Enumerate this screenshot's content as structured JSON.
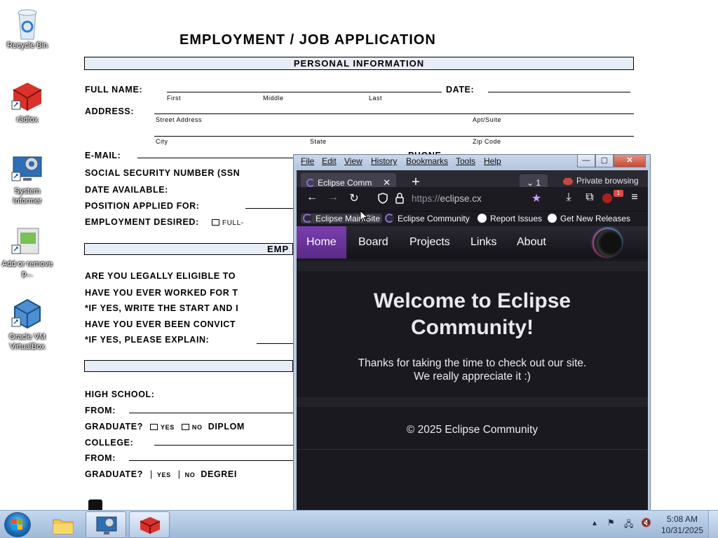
{
  "desktop": {
    "icons": [
      {
        "label": "Recycle Bin",
        "icon": "recycle-bin-icon"
      },
      {
        "label": "r3dfox",
        "icon": "r3dfox-icon"
      },
      {
        "label": "System Informer",
        "icon": "system-informer-icon"
      },
      {
        "label": "Add or remove p...",
        "icon": "add-remove-programs-icon"
      },
      {
        "label": "Oracle VM VirtualBox",
        "icon": "virtualbox-icon"
      }
    ]
  },
  "form": {
    "title": "EMPLOYMENT / JOB APPLICATION",
    "band_personal": "PERSONAL INFORMATION",
    "band_employment_partial": "EMP",
    "full_name_label": "FULL NAME:",
    "first": "First",
    "middle": "Middle",
    "last": "Last",
    "date_label": "DATE:",
    "address_label": "ADDRESS:",
    "street": "Street Address",
    "apt": "Apt/Suite",
    "city": "City",
    "state": "State",
    "zip": "Zip Code",
    "email_label": "E-MAIL:",
    "phone_label": "PHONE",
    "ssn_label": "SOCIAL SECURITY NUMBER (SSN",
    "date_available_label": "DATE AVAILABLE:",
    "position_label": "POSITION APPLIED FOR:",
    "employment_desired_label": "EMPLOYMENT DESIRED:",
    "full_time_partial": "FULL-",
    "eligible_partial": "ARE YOU LEGALLY ELIGIBLE TO",
    "worked_partial": "HAVE YOU EVER WORKED FOR T",
    "if_yes_dates_partial": "*IF YES, WRITE THE START AND I",
    "convicted_partial": "HAVE YOU EVER BEEN CONVICT",
    "if_yes_explain": "*IF YES, PLEASE EXPLAIN:",
    "high_school_label": "HIGH SCHOOL:",
    "from_label": "FROM:",
    "graduate_label": "GRADUATE?",
    "yes": "YES",
    "no": "NO",
    "diploma_partial": "DIPLOM",
    "college_label": "COLLEGE:",
    "from_label_2": "FROM:",
    "graduate_label_2": "GRADUATE?",
    "yes_2": "YES",
    "no_2": "NO",
    "degree_partial": "DEGREI"
  },
  "browser": {
    "menu": [
      "File",
      "Edit",
      "View",
      "History",
      "Bookmarks",
      "Tools",
      "Help"
    ],
    "window_buttons": {
      "minimize": "—",
      "maximize": "▢",
      "close": "✕"
    },
    "tab_title": "Eclipse Comm",
    "tab_close": "✕",
    "new_tab": "+",
    "tab_count": "1",
    "private_label": "Private browsing",
    "url_protocol": "https://",
    "url_host": "eclipse.cx",
    "extension_badge": "1",
    "bookmarks": [
      "Eclipse Main Site",
      "Eclipse Community",
      "Report Issues",
      "Get New Releases"
    ],
    "site_nav": [
      "Home",
      "Board",
      "Projects",
      "Links",
      "About"
    ],
    "welcome_line1": "Welcome to Eclipse",
    "welcome_line2": "Community!",
    "thanks_line1": "Thanks for taking the time to check out our site.",
    "thanks_line2": "We really appreciate it :)",
    "copyright": "© 2025 Eclipse Community"
  },
  "taskbar": {
    "time": "5:08 AM",
    "date": "10/31/2025"
  }
}
